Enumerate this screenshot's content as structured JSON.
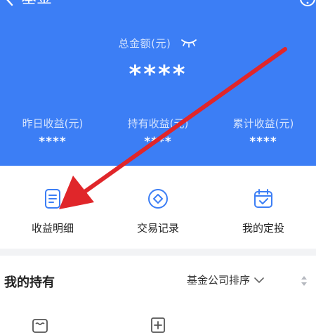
{
  "header": {
    "title": "基金",
    "back_icon": "chevron-left-icon",
    "help_icon": "help-circle-icon"
  },
  "summary": {
    "total_label": "总金额(元)",
    "total_value": "****",
    "eye_icon": "eye-closed-icon"
  },
  "stats": [
    {
      "label": "昨日收益(元)",
      "value": "****"
    },
    {
      "label": "持有收益(元)",
      "value": "****"
    },
    {
      "label": "累计收益(元)",
      "value": "****"
    }
  ],
  "actions": [
    {
      "label": "收益明细",
      "icon": "document-icon"
    },
    {
      "label": "交易记录",
      "icon": "diamond-circle-icon"
    },
    {
      "label": "我的定投",
      "icon": "calendar-check-icon"
    }
  ],
  "holdings": {
    "title": "我的持有",
    "sort_value": "基金公司排序"
  },
  "colors": {
    "primary": "#3c7ef5",
    "annotation_arrow": "#e0262a"
  }
}
